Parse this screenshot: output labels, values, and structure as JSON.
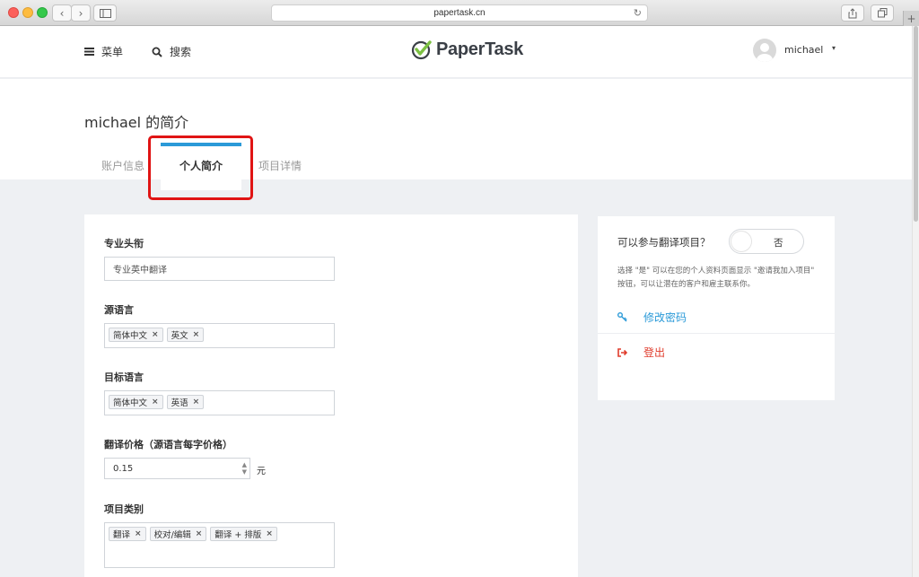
{
  "browser": {
    "url": "papertask.cn",
    "back_icon": "‹",
    "forward_icon": "›",
    "new_tab": "+"
  },
  "header": {
    "menu_label": "菜单",
    "search_label": "搜索",
    "logo_text": "PaperTask",
    "user_name": "michael",
    "caret": "▾"
  },
  "page": {
    "title": "michael 的简介",
    "tabs": [
      {
        "label": "账户信息"
      },
      {
        "label": "个人简介"
      },
      {
        "label": "项目详情"
      }
    ]
  },
  "form": {
    "title_label": "专业头衔",
    "title_value": "专业英中翻译",
    "source_label": "源语言",
    "source_tags": [
      "简体中文",
      "英文"
    ],
    "target_label": "目标语言",
    "target_tags": [
      "简体中文",
      "英语"
    ],
    "price_label": "翻译价格（源语言每字价格）",
    "price_value": "0.15",
    "price_unit": "元",
    "category_label": "项目类别",
    "category_tags": [
      "翻译",
      "校对/编辑",
      "翻译 + 排版"
    ],
    "remove_mark": "×"
  },
  "side": {
    "question": "可以参与翻译项目？",
    "toggle_label": "否",
    "description": "选择 \"是\" 可以在您的个人资料页面显示 \"邀请我加入项目\" 按钮，可以让潜在的客户和雇主联系你。",
    "change_password": "修改密码",
    "logout": "登出"
  },
  "colors": {
    "accent": "#2b9ad8",
    "logout_red": "#e03c2c",
    "highlight_red": "#e01414",
    "logo_green": "#7cc142"
  }
}
